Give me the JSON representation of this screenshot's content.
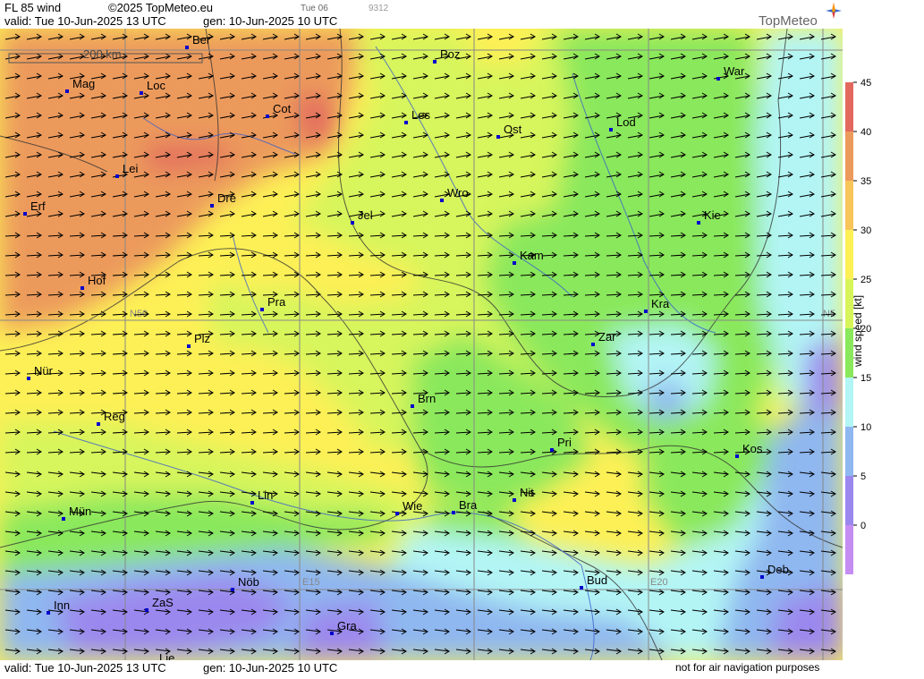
{
  "header": {
    "product": "FL 85 wind",
    "copyright": "©2025 TopMeteo.eu",
    "day_badge": "Tue 06",
    "code": "9312",
    "valid": "valid:  Tue  10-Jun-2025  13 UTC",
    "gen": "gen: 10-Jun-2025 10 UTC",
    "brand": "TopMeteo"
  },
  "footer": {
    "valid": "valid:  Tue  10-Jun-2025  13 UTC",
    "gen": "gen: 10-Jun-2025 10 UTC",
    "disclaimer": "not for air navigation purposes"
  },
  "map": {
    "scale_label": "200 km",
    "grid_labels": [
      "N50",
      "N5",
      "E15",
      "E20"
    ],
    "cities": [
      {
        "name": "Ber"
      },
      {
        "name": "Poz"
      },
      {
        "name": "War"
      },
      {
        "name": "Mag"
      },
      {
        "name": "Loc"
      },
      {
        "name": "Cot"
      },
      {
        "name": "Les"
      },
      {
        "name": "Ost"
      },
      {
        "name": "Lod"
      },
      {
        "name": "Lei"
      },
      {
        "name": "Erf"
      },
      {
        "name": "Dre"
      },
      {
        "name": "Jel"
      },
      {
        "name": "Wro"
      },
      {
        "name": "Kie"
      },
      {
        "name": "Kam"
      },
      {
        "name": "Hof"
      },
      {
        "name": "Pra"
      },
      {
        "name": "Kra"
      },
      {
        "name": "Plz"
      },
      {
        "name": "Zar"
      },
      {
        "name": "Nür"
      },
      {
        "name": "Brn"
      },
      {
        "name": "Reg"
      },
      {
        "name": "Pri"
      },
      {
        "name": "Kos"
      },
      {
        "name": "Lin"
      },
      {
        "name": "Nit"
      },
      {
        "name": "Mün"
      },
      {
        "name": "Wie"
      },
      {
        "name": "Bra"
      },
      {
        "name": "Deb"
      },
      {
        "name": "Nöb"
      },
      {
        "name": "Bud"
      },
      {
        "name": "Inn"
      },
      {
        "name": "ZaS"
      },
      {
        "name": "Gra"
      },
      {
        "name": "Lie"
      }
    ]
  },
  "legend": {
    "title": "wind  speed  [kt]",
    "ticks": [
      "45",
      "40",
      "35",
      "30",
      "25",
      "20",
      "15",
      "10",
      "5",
      "0"
    ],
    "colors": [
      "#e2685e",
      "#ec9a5c",
      "#f7c55a",
      "#fdf056",
      "#d7f55b",
      "#8ae85c",
      "#b3f5f5",
      "#8fb7f0",
      "#9b88ee",
      "#c58cf2"
    ]
  }
}
